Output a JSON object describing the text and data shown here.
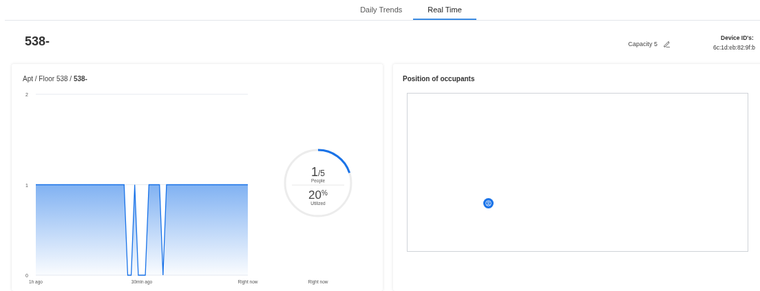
{
  "tabs": [
    {
      "label": "Daily Trends",
      "selected": false
    },
    {
      "label": "Real Time",
      "selected": true
    }
  ],
  "header": {
    "title": "538-",
    "capacity": "Capacity 5",
    "device_label": "Device ID's:",
    "device_id": "6c:1d:eb:82:9f:b"
  },
  "trend_card": {
    "breadcrumb": "Apt / Floor 538 / **538-**",
    "chart_data": {
      "type": "area",
      "categories": [
        "1h ago",
        null,
        null,
        null,
        null,
        null,
        null,
        null,
        null,
        null,
        null,
        null,
        null,
        null,
        null,
        null,
        null,
        null,
        null,
        null,
        null,
        null,
        null,
        null,
        null,
        null,
        null,
        null,
        null,
        null,
        "30min ago",
        null,
        null,
        null,
        null,
        null,
        null,
        null,
        null,
        null,
        null,
        null,
        null,
        null,
        null,
        null,
        null,
        null,
        null,
        null,
        null,
        null,
        null,
        null,
        null,
        null,
        null,
        null,
        null,
        null,
        "Right now"
      ],
      "series": [
        {
          "color": "#1a73e8",
          "values": [
            1,
            1,
            1,
            1,
            1,
            1,
            1,
            1,
            1,
            1,
            1,
            1,
            1,
            1,
            1,
            1,
            1,
            1,
            1,
            1,
            1,
            1,
            1,
            1,
            1,
            1,
            0,
            0,
            1,
            0,
            0,
            0,
            1,
            1,
            1,
            1,
            0,
            1,
            1,
            1,
            1,
            1,
            1,
            1,
            1,
            1,
            1,
            1,
            1,
            1,
            1,
            1,
            1,
            1,
            1,
            1,
            1,
            1,
            1,
            1,
            1
          ]
        }
      ],
      "ylim": [
        0,
        2
      ],
      "yticks": [
        0,
        1,
        2
      ]
    },
    "gauge": {
      "count": "1",
      "total": "/5",
      "count_label": "People",
      "percent": "20",
      "percent_sign": "%",
      "percent_label": "Utilized",
      "time_label": "Right now"
    }
  },
  "position_card": {
    "title": "Position of occupants",
    "occupants": [
      {
        "kind": "person"
      }
    ]
  }
}
